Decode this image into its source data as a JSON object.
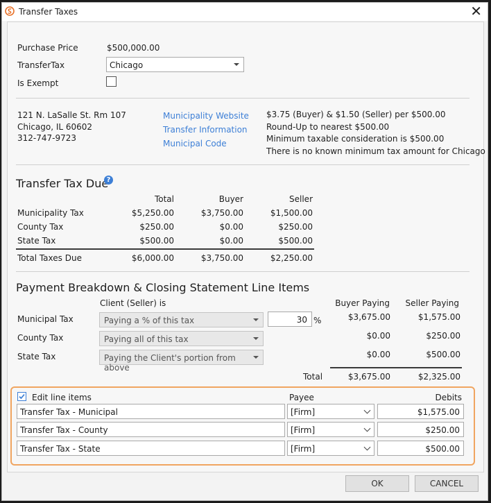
{
  "window": {
    "title": "Transfer Taxes"
  },
  "info": {
    "purchase_price_label": "Purchase Price",
    "purchase_price": "$500,000.00",
    "transfer_tax_label": "TransferTax",
    "transfer_tax_value": "Chicago",
    "is_exempt_label": "Is Exempt"
  },
  "address": {
    "line1": "121 N. LaSalle St. Rm 107",
    "line2": "Chicago, IL 60602",
    "phone": "312-747-9723"
  },
  "links": {
    "website": "Municipality Website",
    "transfer_info": "Transfer Information",
    "code": "Municipal Code"
  },
  "rates": [
    "$3.75 (Buyer) & $1.50 (Seller) per $500.00",
    "Round-Up to nearest $500.00",
    "Minimum taxable consideration is $500.00",
    "There is no known minimum tax amount for Chicago"
  ],
  "due": {
    "title": "Transfer Tax Due",
    "columns": [
      "Total",
      "Buyer",
      "Seller"
    ],
    "rows": [
      {
        "label": "Municipality Tax",
        "total": "$5,250.00",
        "buyer": "$3,750.00",
        "seller": "$1,500.00"
      },
      {
        "label": "County Tax",
        "total": "$250.00",
        "buyer": "$0.00",
        "seller": "$250.00"
      },
      {
        "label": "State Tax",
        "total": "$500.00",
        "buyer": "$0.00",
        "seller": "$500.00"
      }
    ],
    "total_row": {
      "label": "Total Taxes Due",
      "total": "$6,000.00",
      "buyer": "$3,750.00",
      "seller": "$2,250.00"
    }
  },
  "payment": {
    "title": "Payment Breakdown & Closing Statement Line Items",
    "client_label": "Client (Seller) is",
    "buyer_col": "Buyer Paying",
    "seller_col": "Seller Paying",
    "rows": [
      {
        "label": "Municipal Tax",
        "option": "Paying a % of this tax",
        "buyer": "$3,675.00",
        "seller": "$1,575.00"
      },
      {
        "label": "County Tax",
        "option": "Paying all of this tax",
        "buyer": "$0.00",
        "seller": "$250.00"
      },
      {
        "label": "State Tax",
        "option": "Paying the Client's portion from above",
        "buyer": "$0.00",
        "seller": "$500.00"
      }
    ],
    "percent_value": "30",
    "percent_sign": "%",
    "total_label": "Total",
    "total_buyer": "$3,675.00",
    "total_seller": "$2,325.00"
  },
  "line_items": {
    "edit_label": "Edit line items",
    "payee_col": "Payee",
    "debits_col": "Debits",
    "rows": [
      {
        "name": "Transfer Tax - Municipal",
        "payee": "[Firm]",
        "debit": "$1,575.00"
      },
      {
        "name": "Transfer Tax - County",
        "payee": "[Firm]",
        "debit": "$250.00"
      },
      {
        "name": "Transfer Tax - State",
        "payee": "[Firm]",
        "debit": "$500.00"
      }
    ]
  },
  "buttons": {
    "ok": "OK",
    "cancel": "CANCEL"
  },
  "colors": {
    "accent": "#3d7fd6",
    "highlight": "#f0a560"
  }
}
